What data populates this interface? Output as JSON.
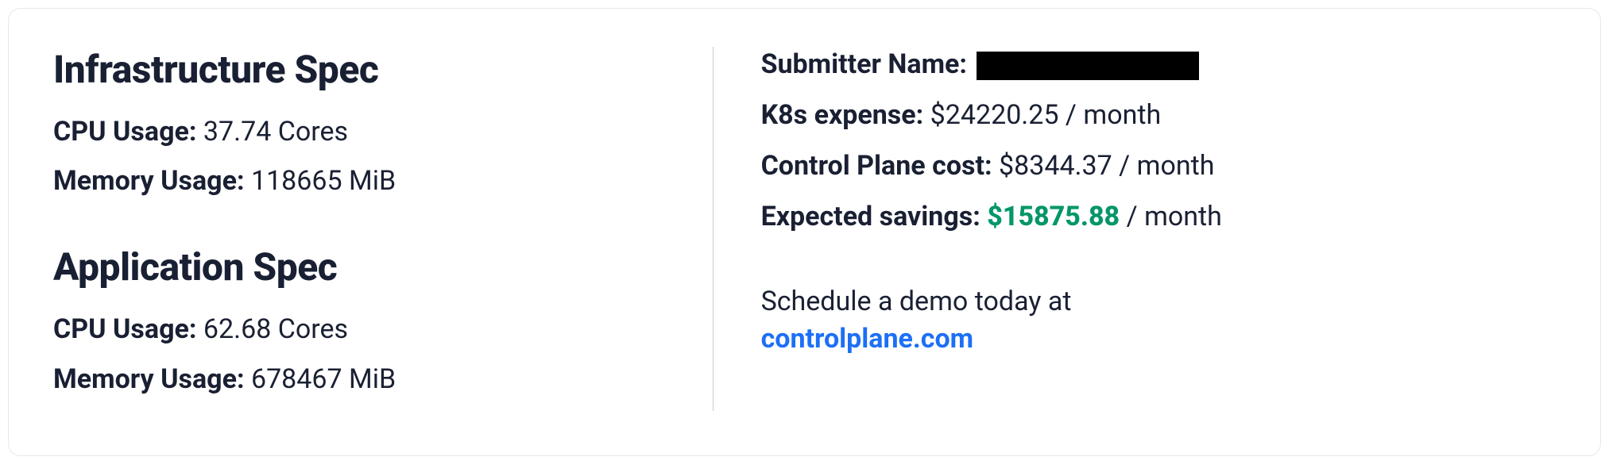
{
  "left": {
    "infra": {
      "title": "Infrastructure Spec",
      "cpu_label": "CPU Usage:",
      "cpu_value": "37.74 Cores",
      "mem_label": "Memory Usage:",
      "mem_value": "118665 MiB"
    },
    "app": {
      "title": "Application Spec",
      "cpu_label": "CPU Usage:",
      "cpu_value": "62.68 Cores",
      "mem_label": "Memory Usage:",
      "mem_value": "678467 MiB"
    }
  },
  "right": {
    "submitter_label": "Submitter Name:",
    "k8s_label": "K8s expense:",
    "k8s_value": "$24220.25 / month",
    "cp_label": "Control Plane cost:",
    "cp_value": "$8344.37 / month",
    "savings_label": "Expected savings:",
    "savings_amount": "$15875.88",
    "savings_suffix": " / month",
    "cta_text": "Schedule a demo today at ",
    "cta_link": "controlplane.com"
  }
}
